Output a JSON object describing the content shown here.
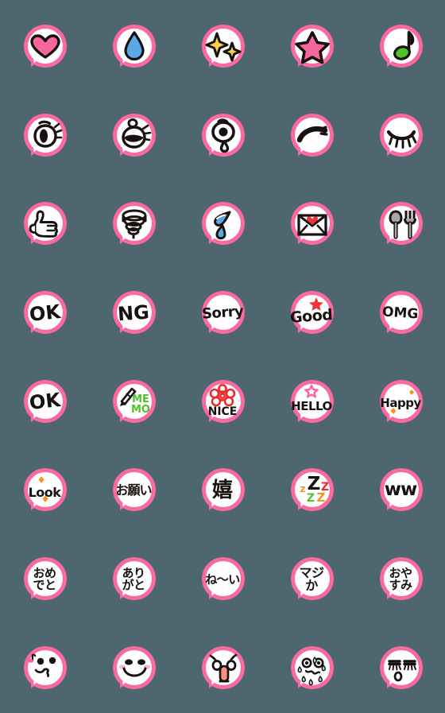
{
  "page": {
    "title": "Emoji Sticker Sheet",
    "background_color": "#4d6670",
    "bubble_border_color": "#fa6a9e",
    "bubble_fill_color": "#ffffff",
    "columns": 5,
    "rows": 8,
    "total_stickers": 40
  },
  "stickers": [
    {
      "id": "heart",
      "name": "heart-emoji",
      "label": "",
      "icon": "heart-icon",
      "row": 1,
      "col": 1,
      "colors": [
        "#f7679e",
        "#17120f"
      ]
    },
    {
      "id": "water-drop",
      "name": "water-drop-emoji",
      "label": "",
      "icon": "water-drop-icon",
      "row": 1,
      "col": 2,
      "colors": [
        "#5aa9e6",
        "#17120f"
      ]
    },
    {
      "id": "sparkles",
      "name": "sparkles-emoji",
      "label": "",
      "icon": "sparkles-icon",
      "row": 1,
      "col": 3,
      "colors": [
        "#f7cf4e",
        "#17120f"
      ]
    },
    {
      "id": "star",
      "name": "star-emoji",
      "label": "",
      "icon": "star-icon",
      "row": 1,
      "col": 4,
      "colors": [
        "#f7679e",
        "#17120f"
      ]
    },
    {
      "id": "music-note",
      "name": "music-note-emoji",
      "label": "",
      "icon": "music-note-icon",
      "row": 1,
      "col": 5,
      "colors": [
        "#4fc22c",
        "#17120f"
      ]
    },
    {
      "id": "eye-open",
      "name": "eye-open-emoji",
      "label": "",
      "icon": "eye-open-icon",
      "row": 2,
      "col": 1,
      "colors": [
        "#17120f"
      ]
    },
    {
      "id": "eye-wink",
      "name": "eye-wink-emoji",
      "label": "",
      "icon": "eye-wink-icon",
      "row": 2,
      "col": 2,
      "colors": [
        "#17120f"
      ]
    },
    {
      "id": "eye-tear",
      "name": "eye-teardrop-emoji",
      "label": "",
      "icon": "eye-teardrop-icon",
      "row": 2,
      "col": 3,
      "colors": [
        "#17120f"
      ]
    },
    {
      "id": "eyebrow",
      "name": "eyebrow-emoji",
      "label": "",
      "icon": "eyebrow-icon",
      "row": 2,
      "col": 4,
      "colors": [
        "#17120f"
      ]
    },
    {
      "id": "eye-closed",
      "name": "eye-closed-emoji",
      "label": "",
      "icon": "eye-closed-icon",
      "row": 2,
      "col": 5,
      "colors": [
        "#17120f"
      ]
    },
    {
      "id": "thumbs-up",
      "name": "thumbs-up-emoji",
      "label": "",
      "icon": "thumbs-up-icon",
      "row": 3,
      "col": 1,
      "colors": [
        "#17120f"
      ]
    },
    {
      "id": "spiral",
      "name": "spiral-emoji",
      "label": "",
      "icon": "spiral-icon",
      "row": 3,
      "col": 2,
      "colors": [
        "#17120f"
      ]
    },
    {
      "id": "sweat-drops",
      "name": "sweat-drops-emoji",
      "label": "",
      "icon": "sweat-drops-icon",
      "row": 3,
      "col": 3,
      "colors": [
        "#5aa9e6",
        "#17120f"
      ]
    },
    {
      "id": "love-letter",
      "name": "love-letter-emoji",
      "label": "",
      "icon": "love-letter-icon",
      "row": 3,
      "col": 4,
      "colors": [
        "#f2333b",
        "#17120f"
      ]
    },
    {
      "id": "cutlery",
      "name": "spoon-fork-emoji",
      "label": "",
      "icon": "spoon-fork-icon",
      "row": 3,
      "col": 5,
      "colors": [
        "#a8a8a8",
        "#17120f"
      ]
    },
    {
      "id": "ok-1",
      "name": "ok-text-emoji",
      "label": "OK",
      "icon": "text-glyph",
      "row": 4,
      "col": 1,
      "colors": [
        "#17120f"
      ]
    },
    {
      "id": "ng",
      "name": "ng-text-emoji",
      "label": "NG",
      "icon": "text-glyph",
      "row": 4,
      "col": 2,
      "colors": [
        "#17120f"
      ]
    },
    {
      "id": "sorry",
      "name": "sorry-text-emoji",
      "label": "Sorry",
      "icon": "text-glyph",
      "row": 4,
      "col": 3,
      "colors": [
        "#17120f"
      ]
    },
    {
      "id": "good",
      "name": "good-text-emoji",
      "label": "Good",
      "icon": "text-glyph-star",
      "row": 4,
      "col": 4,
      "colors": [
        "#f2333b",
        "#17120f"
      ]
    },
    {
      "id": "omg",
      "name": "omg-text-emoji",
      "label": "OMG",
      "icon": "text-glyph",
      "row": 4,
      "col": 5,
      "colors": [
        "#17120f"
      ]
    },
    {
      "id": "ok-2",
      "name": "ok-text-emoji-2",
      "label": "OK",
      "icon": "text-glyph",
      "row": 5,
      "col": 1,
      "colors": [
        "#17120f"
      ]
    },
    {
      "id": "memo",
      "name": "memo-text-emoji",
      "label": "MEMO",
      "icon": "brush-icon",
      "row": 5,
      "col": 2,
      "colors": [
        "#4fc22c",
        "#17120f"
      ]
    },
    {
      "id": "nice",
      "name": "nice-text-emoji",
      "label": "NICE",
      "icon": "flower-icon",
      "row": 5,
      "col": 3,
      "colors": [
        "#ee2b2b",
        "#17120f"
      ]
    },
    {
      "id": "hello",
      "name": "hello-text-emoji",
      "label": "HELLO",
      "icon": "star-outline-icon",
      "row": 5,
      "col": 4,
      "colors": [
        "#f7679e",
        "#17120f"
      ]
    },
    {
      "id": "happy",
      "name": "happy-text-emoji",
      "label": "Happy",
      "icon": "diamond-sparkle-icon",
      "row": 5,
      "col": 5,
      "colors": [
        "#f59425",
        "#17120f"
      ]
    },
    {
      "id": "look",
      "name": "look-text-emoji",
      "label": "Look",
      "icon": "diamond-sparkle-icon",
      "row": 6,
      "col": 1,
      "colors": [
        "#f59425",
        "#17120f"
      ]
    },
    {
      "id": "onegai",
      "name": "onegai-text-emoji",
      "label": "お願い",
      "icon": "text-glyph",
      "row": 6,
      "col": 2,
      "colors": [
        "#17120f"
      ]
    },
    {
      "id": "ureshii",
      "name": "ureshii-text-emoji",
      "label": "嬉",
      "icon": "text-glyph",
      "row": 6,
      "col": 3,
      "colors": [
        "#17120f"
      ]
    },
    {
      "id": "zzz",
      "name": "sleeping-zzz-emoji",
      "label": "zZzZz",
      "icon": "zzz-icon",
      "row": 6,
      "col": 4,
      "colors": [
        "#17120f",
        "#ee2b2b",
        "#f59425",
        "#4fc22c"
      ]
    },
    {
      "id": "ww",
      "name": "laugh-ww-emoji",
      "label": "ww",
      "icon": "text-glyph",
      "row": 6,
      "col": 5,
      "colors": [
        "#17120f"
      ]
    },
    {
      "id": "omedeto",
      "name": "omedeto-text-emoji",
      "label": "おめ\nでと",
      "icon": "text-glyph",
      "row": 7,
      "col": 1,
      "colors": [
        "#17120f"
      ]
    },
    {
      "id": "arigato",
      "name": "arigato-text-emoji",
      "label": "あり\nがと",
      "icon": "text-glyph",
      "row": 7,
      "col": 2,
      "colors": [
        "#17120f"
      ]
    },
    {
      "id": "nei",
      "name": "nei-text-emoji",
      "label": "ね〜い",
      "icon": "text-glyph",
      "row": 7,
      "col": 3,
      "colors": [
        "#17120f"
      ]
    },
    {
      "id": "majika",
      "name": "majika-text-emoji",
      "label": "マジ\nか",
      "icon": "text-glyph",
      "row": 7,
      "col": 4,
      "colors": [
        "#17120f"
      ]
    },
    {
      "id": "oyasumi",
      "name": "oyasumi-text-emoji",
      "label": "おや\nすみ",
      "icon": "text-glyph",
      "row": 7,
      "col": 5,
      "colors": [
        "#17120f"
      ]
    },
    {
      "id": "face-kiss",
      "name": "kissing-face-emoji",
      "label": "",
      "icon": "kissing-face-icon",
      "row": 8,
      "col": 1,
      "colors": [
        "#f7679e",
        "#17120f"
      ]
    },
    {
      "id": "face-smile",
      "name": "smiling-face-emoji",
      "label": "",
      "icon": "smiling-face-icon",
      "row": 8,
      "col": 2,
      "colors": [
        "#fbb6c9",
        "#17120f"
      ]
    },
    {
      "id": "face-angry",
      "name": "angry-shout-face-emoji",
      "label": "",
      "icon": "angry-shout-face-icon",
      "row": 8,
      "col": 3,
      "colors": [
        "#f79184",
        "#17120f"
      ]
    },
    {
      "id": "face-sweat",
      "name": "nervous-sweat-face-emoji",
      "label": "",
      "icon": "nervous-sweat-face-icon",
      "row": 8,
      "col": 4,
      "colors": [
        "#9fd8f2",
        "#17120f"
      ]
    },
    {
      "id": "face-sleepy",
      "name": "sleepy-face-emoji",
      "label": "",
      "icon": "sleepy-face-icon",
      "row": 8,
      "col": 5,
      "colors": [
        "#17120f"
      ]
    }
  ]
}
